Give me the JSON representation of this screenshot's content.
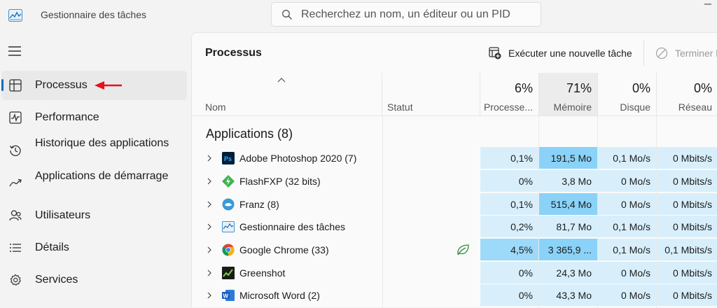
{
  "app": {
    "title": "Gestionnaire des tâches"
  },
  "search": {
    "placeholder": "Recherchez un nom, un éditeur ou un PID"
  },
  "sidebar": {
    "items": [
      {
        "label": "Processus",
        "icon": "processes-icon",
        "active": true
      },
      {
        "label": "Performance",
        "icon": "performance-icon"
      },
      {
        "label": "Historique des applications",
        "icon": "history-icon"
      },
      {
        "label": "Applications de démarrage",
        "icon": "startup-icon"
      },
      {
        "label": "Utilisateurs",
        "icon": "users-icon"
      },
      {
        "label": "Détails",
        "icon": "details-icon"
      },
      {
        "label": "Services",
        "icon": "services-icon"
      }
    ]
  },
  "toolbar": {
    "title": "Processus",
    "run_task": "Exécuter une nouvelle tâche",
    "end_task": "Terminer l"
  },
  "columns": {
    "name": "Nom",
    "status": "Statut",
    "cpu": {
      "pct": "6%",
      "label": "Processe..."
    },
    "memory": {
      "pct": "71%",
      "label": "Mémoire"
    },
    "disk": {
      "pct": "0%",
      "label": "Disque"
    },
    "network": {
      "pct": "0%",
      "label": "Réseau"
    }
  },
  "group": {
    "title": "Applications (8)"
  },
  "rows": [
    {
      "name": "Adobe Photoshop 2020 (7)",
      "icon": "photoshop-icon",
      "cpu": "0,1%",
      "mem": "191,5 Mo",
      "disk": "0,1 Mo/s",
      "net": "0 Mbits/s"
    },
    {
      "name": "FlashFXP (32 bits)",
      "icon": "flashfxp-icon",
      "cpu": "0%",
      "mem": "3,8 Mo",
      "disk": "0 Mo/s",
      "net": "0 Mbits/s"
    },
    {
      "name": "Franz (8)",
      "icon": "franz-icon",
      "cpu": "0,1%",
      "mem": "515,4 Mo",
      "disk": "0 Mo/s",
      "net": "0 Mbits/s"
    },
    {
      "name": "Gestionnaire des tâches",
      "icon": "task-manager-icon",
      "cpu": "0,2%",
      "mem": "81,7 Mo",
      "disk": "0,1 Mo/s",
      "net": "0 Mbits/s"
    },
    {
      "name": "Google Chrome (33)",
      "icon": "chrome-icon",
      "cpu": "4,5%",
      "mem": "3 365,9 ...",
      "disk": "0,1 Mo/s",
      "net": "0,1 Mbits/s",
      "eco": true
    },
    {
      "name": "Greenshot",
      "icon": "greenshot-icon",
      "cpu": "0%",
      "mem": "24,3 Mo",
      "disk": "0 Mo/s",
      "net": "0 Mbits/s"
    },
    {
      "name": "Microsoft Word (2)",
      "icon": "word-icon",
      "cpu": "0%",
      "mem": "43,3 Mo",
      "disk": "0 Mo/s",
      "net": "0 Mbits/s"
    }
  ],
  "colors": {
    "accent": "#0f6cbd",
    "heat_low": "#d8effb",
    "heat_mid": "#b7e1f7",
    "heat_high": "#8ad2f8",
    "heat_cpu_high": "#9dd9f8",
    "annotation_arrow": "#e8101a"
  }
}
